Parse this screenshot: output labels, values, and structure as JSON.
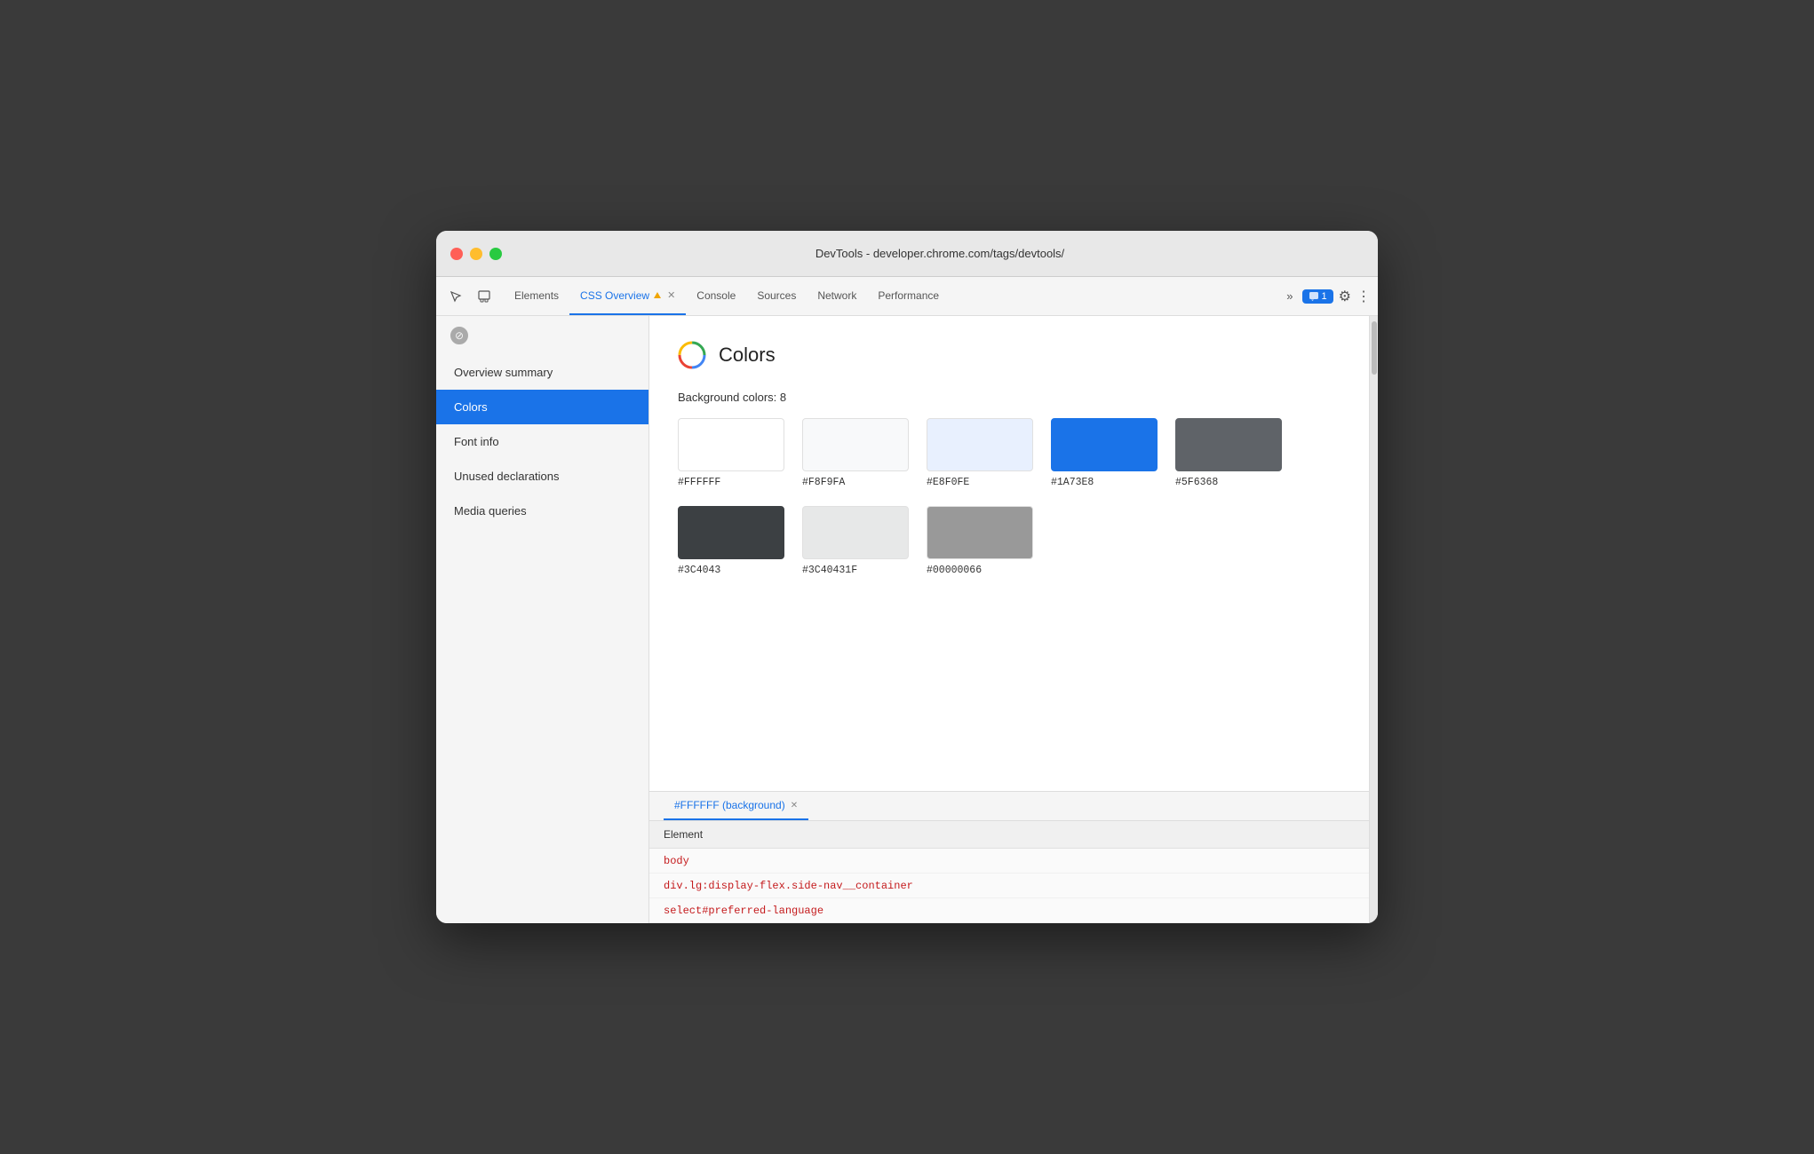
{
  "window": {
    "title": "DevTools - developer.chrome.com/tags/devtools/"
  },
  "tabs": [
    {
      "id": "elements",
      "label": "Elements",
      "active": false
    },
    {
      "id": "css-overview",
      "label": "CSS Overview",
      "active": true,
      "closable": true
    },
    {
      "id": "console",
      "label": "Console",
      "active": false
    },
    {
      "id": "sources",
      "label": "Sources",
      "active": false
    },
    {
      "id": "network",
      "label": "Network",
      "active": false
    },
    {
      "id": "performance",
      "label": "Performance",
      "active": false
    }
  ],
  "more_tabs_label": "»",
  "chat_badge_label": "1",
  "sidebar": {
    "items": [
      {
        "id": "overview-summary",
        "label": "Overview summary",
        "active": false
      },
      {
        "id": "colors",
        "label": "Colors",
        "active": true
      },
      {
        "id": "font-info",
        "label": "Font info",
        "active": false
      },
      {
        "id": "unused-declarations",
        "label": "Unused declarations",
        "active": false
      },
      {
        "id": "media-queries",
        "label": "Media queries",
        "active": false
      }
    ]
  },
  "panel": {
    "title": "Colors",
    "background_colors_label": "Background colors: 8",
    "colors": [
      {
        "id": "ffffff",
        "hex": "#FFFFFF",
        "display": "#FFFFFF",
        "bg": "#FFFFFF"
      },
      {
        "id": "f8f9fa",
        "hex": "#F8F9FA",
        "display": "#F8F9FA",
        "bg": "#F8F9FA"
      },
      {
        "id": "e8f0fe",
        "hex": "#E8F0FE",
        "display": "#E8F0FE",
        "bg": "#E8F0FE"
      },
      {
        "id": "1a73e8",
        "hex": "#1A73E8",
        "display": "#1A73E8",
        "bg": "#1A73E8"
      },
      {
        "id": "5f6368",
        "hex": "#5F6368",
        "display": "#5F6368",
        "bg": "#5F6368"
      },
      {
        "id": "3c4043",
        "hex": "#3C4043",
        "display": "#3C4043",
        "bg": "#3C4043"
      },
      {
        "id": "3c40431f",
        "hex": "#3C40431F",
        "display": "#3C40431F",
        "bg": "#EBEBEB"
      },
      {
        "id": "00000066",
        "hex": "#00000066",
        "display": "#00000066",
        "bg": "#A0A0A0"
      }
    ],
    "bottom_tab_label": "#FFFFFF (background)",
    "element_header": "Element",
    "elements": [
      {
        "name": "body",
        "selector": "body"
      },
      {
        "name": "div.lg:display-flex.side-nav__container",
        "selector": "div.lg:display-flex.side-nav__container"
      },
      {
        "name": "select#preferred-language",
        "selector": "select#preferred-language"
      }
    ]
  }
}
